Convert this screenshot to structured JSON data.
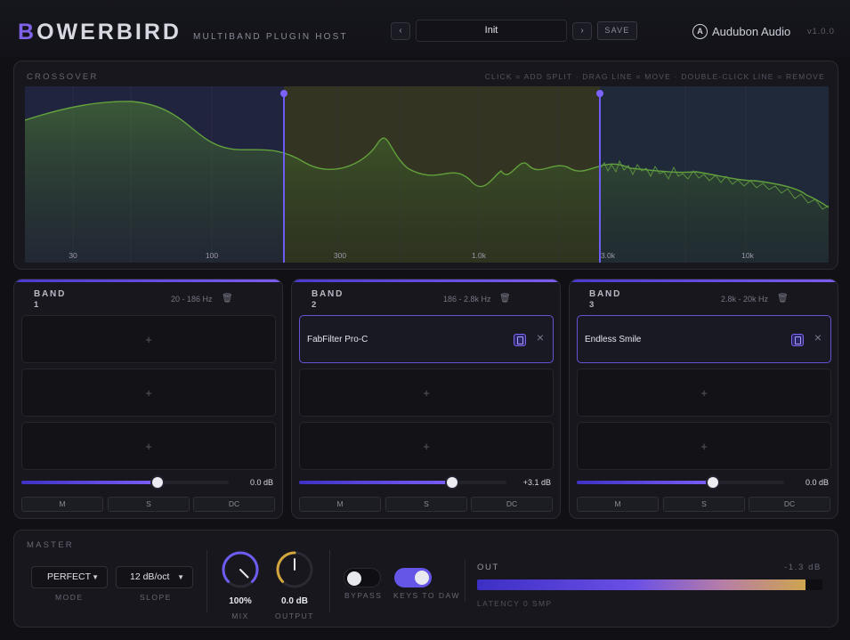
{
  "header": {
    "logo_first": "B",
    "logo_rest": "OWERBIRD",
    "subtitle": "MULTIBAND PLUGIN HOST",
    "prev_icon": "‹",
    "next_icon": "›",
    "preset": "Init",
    "save": "SAVE",
    "brand_mark": "A",
    "brand": "Audubon Audio",
    "version": "v1.0.0"
  },
  "crossover": {
    "label": "CROSSOVER",
    "help": "CLICK = ADD SPLIT · DRAG LINE = MOVE · DOUBLE-CLICK LINE = REMOVE",
    "freq_labels": [
      "30",
      "100",
      "300",
      "1.0k",
      "3.0k",
      "10k"
    ],
    "split_points_hz": [
      186,
      2800
    ],
    "colors": {
      "low": "#23284a",
      "mid": "#3a3b27",
      "high": "#253046",
      "curve": "#63a13d",
      "split": "#6d5cf2"
    }
  },
  "bands": [
    {
      "title": "BAND",
      "number": "1",
      "range": "20 - 186 Hz",
      "trash": "🗑",
      "slots": [
        null,
        null,
        null
      ],
      "gain": "0.0 dB",
      "gain_fraction": 0.65,
      "buttons": [
        "M",
        "S",
        "DC"
      ]
    },
    {
      "title": "BAND",
      "number": "2",
      "range": "186 - 2.8k Hz",
      "trash": "🗑",
      "slots": [
        "FabFilter Pro-C",
        null,
        null
      ],
      "gain": "+3.1 dB",
      "gain_fraction": 0.73,
      "buttons": [
        "M",
        "S",
        "DC"
      ]
    },
    {
      "title": "BAND",
      "number": "3",
      "range": "2.8k - 20k Hz",
      "trash": "🗑",
      "slots": [
        "Endless Smile",
        null,
        null
      ],
      "gain": "0.0 dB",
      "gain_fraction": 0.65,
      "buttons": [
        "M",
        "S",
        "DC"
      ]
    }
  ],
  "master": {
    "label": "MASTER",
    "mode": {
      "value": "PERFECT",
      "caption": "MODE"
    },
    "slope": {
      "value": "12 dB/oct",
      "caption": "SLOPE"
    },
    "mix": {
      "value": "100%",
      "caption": "MIX",
      "level": 1.0,
      "color": "#6d5cf2"
    },
    "output": {
      "value": "0.0 dB",
      "caption": "OUTPUT",
      "level": 0.5,
      "color": "#d4a63c"
    },
    "bypass": {
      "caption": "BYPASS",
      "on": false
    },
    "keys_to_daw": {
      "caption": "KEYS TO DAW",
      "on": true
    },
    "out": {
      "label": "OUT",
      "db": "-1.3 dB",
      "level": 0.95,
      "latency": "LATENCY 0 SMP"
    }
  }
}
